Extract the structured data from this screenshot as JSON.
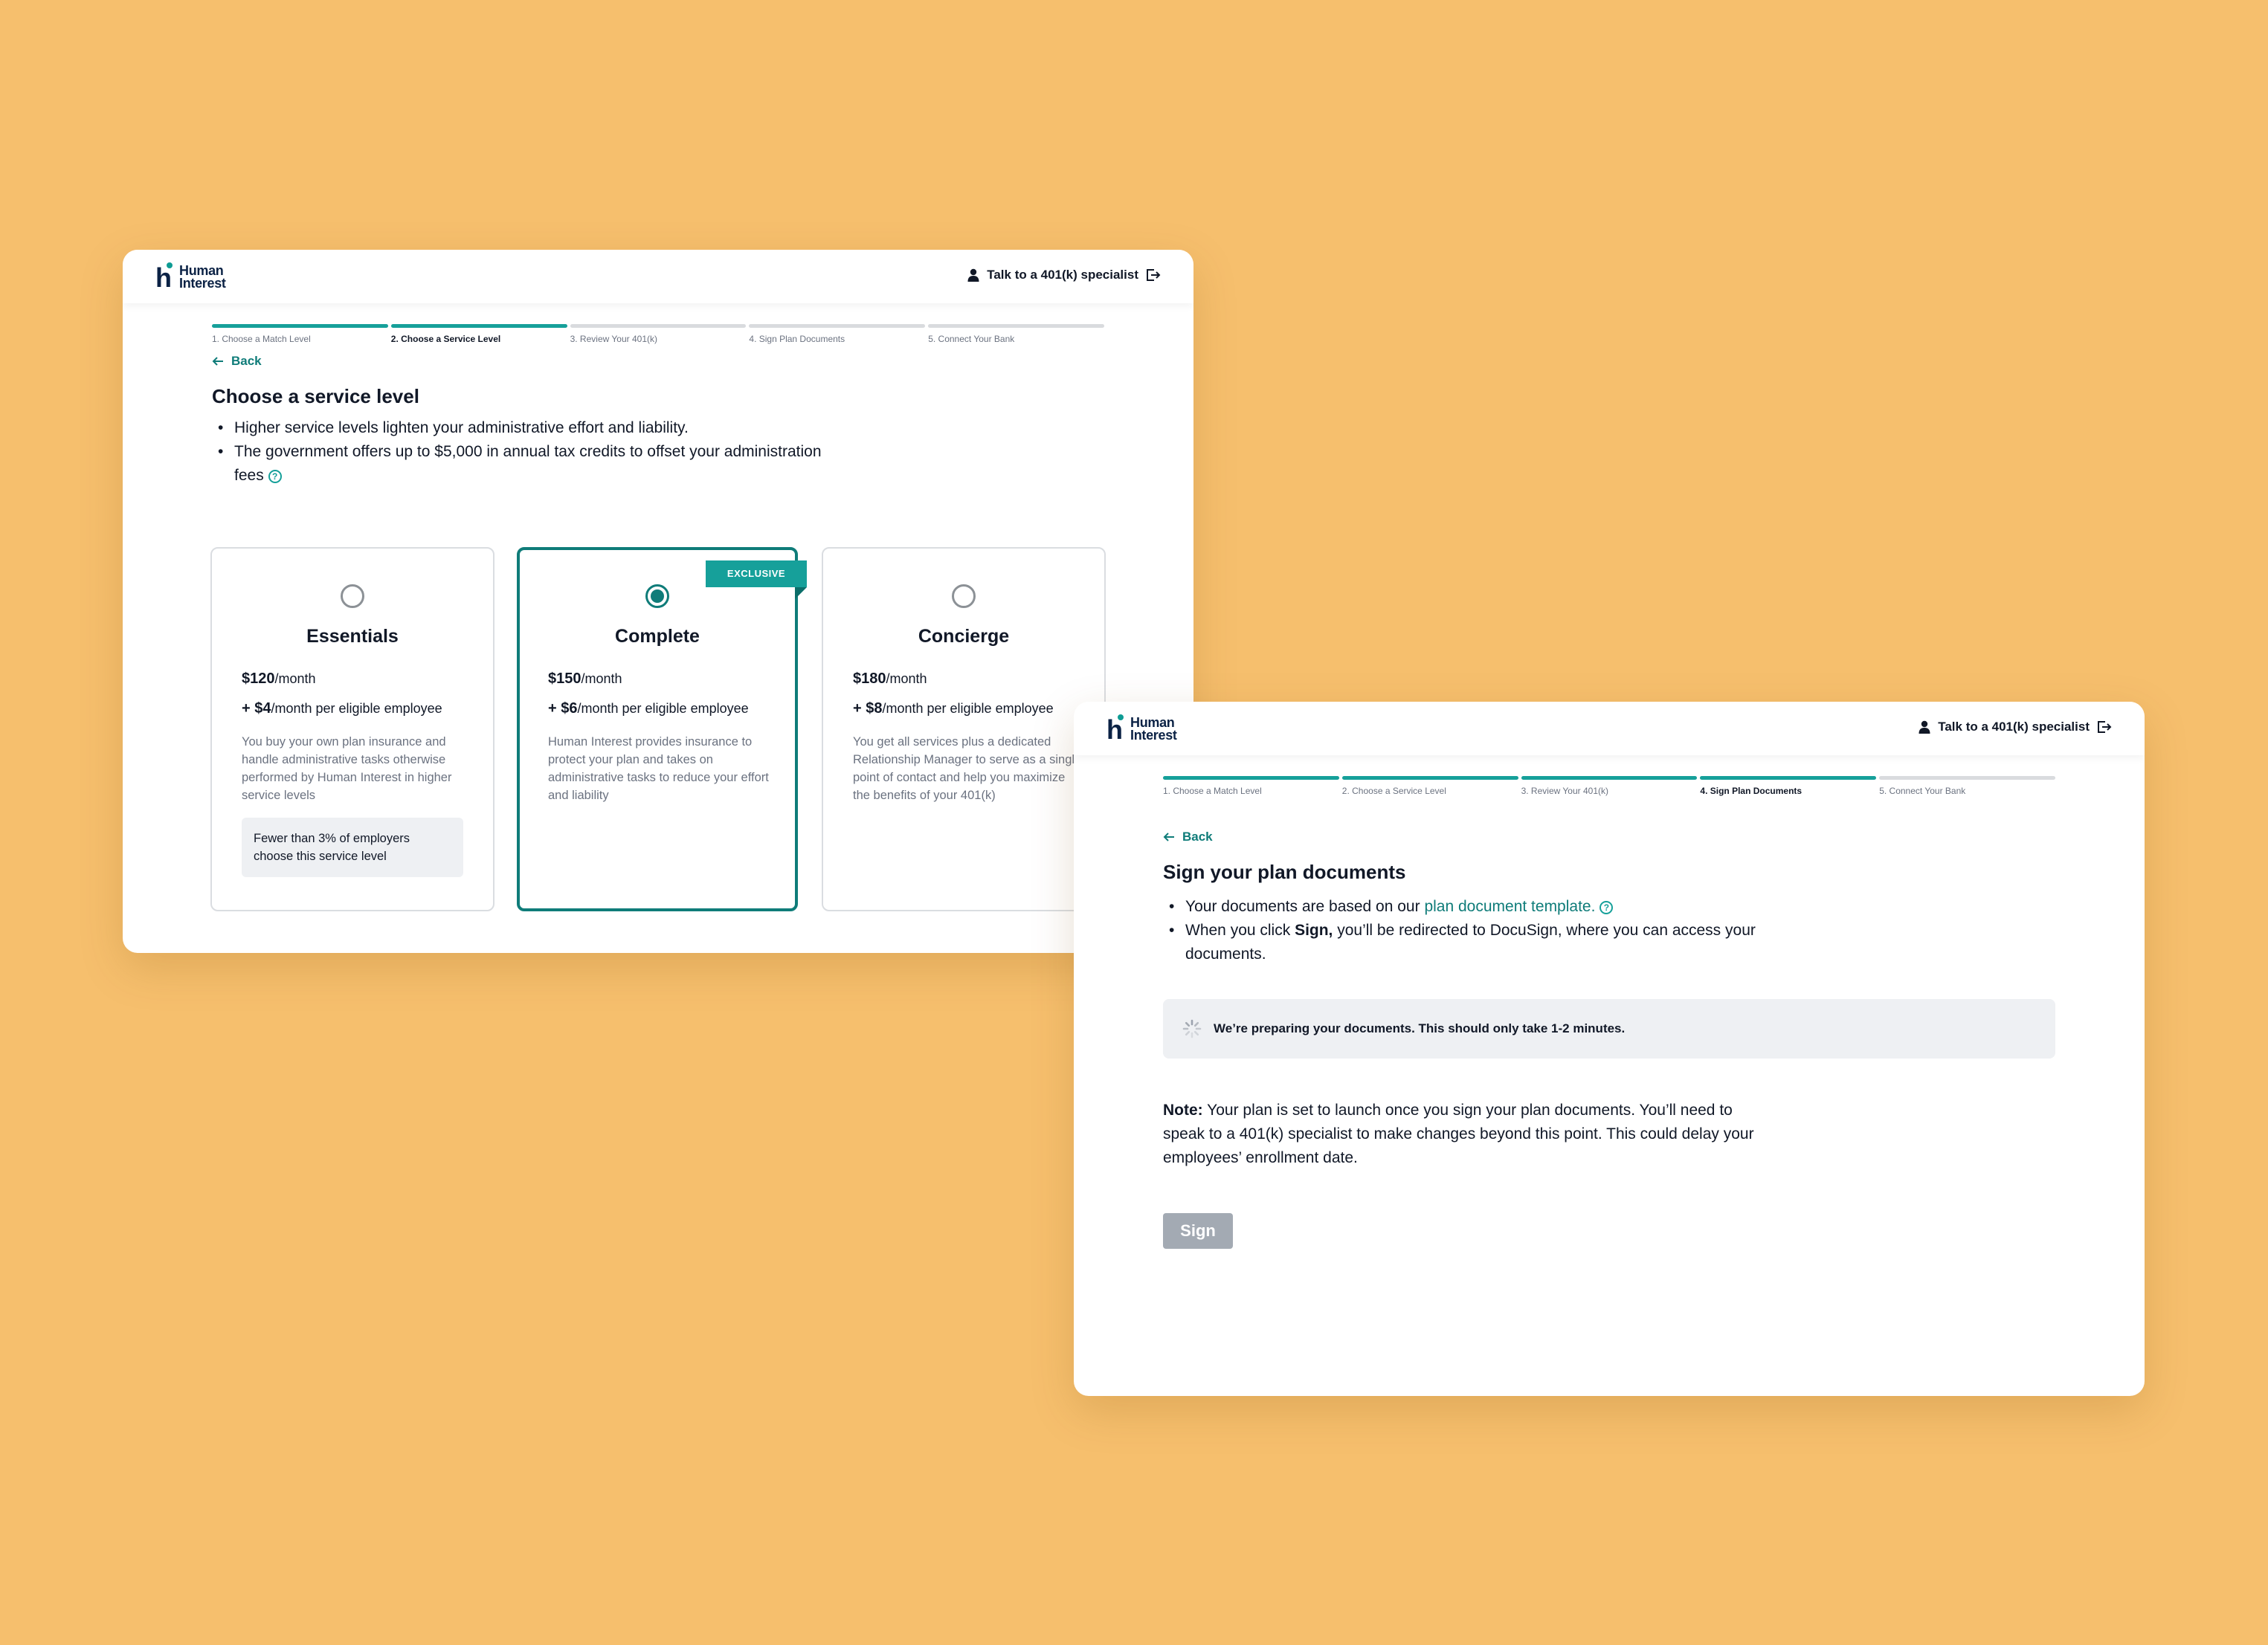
{
  "brand": {
    "logo_text": "Human Interest"
  },
  "window1": {
    "header": {
      "talk_label": "Talk to a 401(k) specialist"
    },
    "steps": [
      {
        "label": "1. Choose a Match Level"
      },
      {
        "label": "2. Choose a Service Level"
      },
      {
        "label": "3. Review Your 401(k)"
      },
      {
        "label": "4. Sign Plan Documents"
      },
      {
        "label": "5. Connect Your Bank"
      }
    ],
    "back_label": "Back",
    "title": "Choose a service level",
    "bullets": [
      "Higher service levels lighten your administrative effort and liability.",
      "The government offers up to $5,000 in annual tax credits to offset your administration fees"
    ],
    "cards": [
      {
        "name": "Essentials",
        "price": "$120",
        "price_unit": "/month",
        "per_employee": "+ $4",
        "per_employee_unit": "/month per eligible employee",
        "description": "You buy your own plan insurance and handle administrative tasks otherwise performed by Human Interest in higher service levels",
        "note": "Fewer than 3% of employers choose this service level",
        "selected": false
      },
      {
        "name": "Complete",
        "price": "$150",
        "price_unit": "/month",
        "per_employee": "+ $6",
        "per_employee_unit": "/month per eligible employee",
        "description": "Human Interest provides insurance to protect your plan and takes on administrative tasks to reduce your effort and liability",
        "badge": "EXCLUSIVE",
        "selected": true
      },
      {
        "name": "Concierge",
        "price": "$180",
        "price_unit": "/month",
        "per_employee": "+ $8",
        "per_employee_unit": "/month per eligible employee",
        "description": "You get all services plus a dedicated Relationship Manager to serve as a single point of contact and help you maximize the benefits of your 401(k)",
        "selected": false
      }
    ]
  },
  "window2": {
    "header": {
      "talk_label": "Talk to a 401(k) specialist"
    },
    "steps": [
      {
        "label": "1. Choose a Match Level"
      },
      {
        "label": "2. Choose a Service Level"
      },
      {
        "label": "3. Review Your 401(k)"
      },
      {
        "label": "4. Sign Plan Documents"
      },
      {
        "label": "5. Connect Your Bank"
      }
    ],
    "back_label": "Back",
    "title": "Sign your plan documents",
    "bullet1_prefix": "Your documents are based on our ",
    "bullet1_link": "plan document template.",
    "bullet2_prefix": "When you click ",
    "bullet2_bold": "Sign,",
    "bullet2_suffix": " you’ll be redirected to DocuSign, where you can access your documents.",
    "loading_text": "We’re preparing your documents. This should only take 1-2 minutes.",
    "note_label": "Note:",
    "note_text": " Your plan is set to launch once you sign your plan documents. You’ll need to speak to a 401(k) specialist to make changes beyond this point. This could delay your employees’ enrollment date.",
    "sign_label": "Sign"
  },
  "colors": {
    "background": "#F6BF6D",
    "accent": "#16A09A",
    "accent_dark": "#0F7C79",
    "brand_navy": "#0B2245"
  }
}
